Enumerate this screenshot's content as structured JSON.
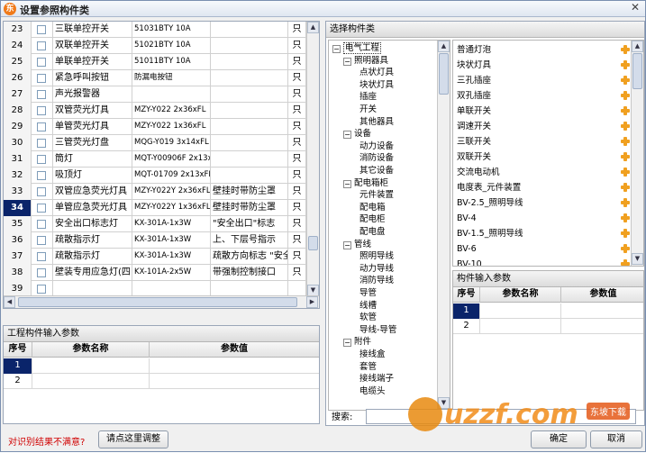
{
  "window": {
    "title": "设置参照构件类",
    "app_icon": "东",
    "close_glyph": "✕"
  },
  "main_grid": {
    "rows": [
      {
        "num": "23",
        "name": "三联单控开关",
        "model": "51031BTY 10A",
        "note": "",
        "unit": "只"
      },
      {
        "num": "24",
        "name": "双联单控开关",
        "model": "51021BTY 10A",
        "note": "",
        "unit": "只"
      },
      {
        "num": "25",
        "name": "单联单控开关",
        "model": "51011BTY 10A",
        "note": "",
        "unit": "只"
      },
      {
        "num": "26",
        "name": "紧急呼叫按钮",
        "model": "防漏电按钮",
        "note": "",
        "unit": "只"
      },
      {
        "num": "27",
        "name": "声光报警器",
        "model": "",
        "note": "",
        "unit": "只"
      },
      {
        "num": "28",
        "name": "双管荧光灯具",
        "model": "MZY-Y022 2x36xFL",
        "note": "",
        "unit": "只"
      },
      {
        "num": "29",
        "name": "单管荧光灯具",
        "model": "MZY-Y022 1x36xFL",
        "note": "",
        "unit": "只"
      },
      {
        "num": "30",
        "name": "三管荧光灯盘",
        "model": "MQG-Y019 3x14xFL",
        "note": "",
        "unit": "只"
      },
      {
        "num": "31",
        "name": "筒灯",
        "model": "MQT-Y00906F 2x13x",
        "note": "",
        "unit": "只"
      },
      {
        "num": "32",
        "name": "吸顶灯",
        "model": "MQT-01709 2x13xFL",
        "note": "",
        "unit": "只"
      },
      {
        "num": "33",
        "name": "双管应急荧光灯具",
        "model": "MZY-Y022Y 2x36xFL",
        "note": "壁挂时带防尘罩",
        "unit": "只"
      },
      {
        "num": "34",
        "name": "单管应急荧光灯具",
        "model": "MZY-Y022Y 1x36xFL",
        "note": "壁挂时带防尘罩",
        "unit": "只"
      },
      {
        "num": "35",
        "name": "安全出口标志灯",
        "model": "KX-301A-1x3W",
        "note": "\"安全出口\"标志",
        "unit": "只"
      },
      {
        "num": "36",
        "name": "疏散指示灯",
        "model": "KX-301A-1x3W",
        "note": "上、下层号指示",
        "unit": "只"
      },
      {
        "num": "37",
        "name": "疏散指示灯",
        "model": "KX-301A-1x3W",
        "note": "疏散方向标志 \"安全",
        "unit": "只"
      },
      {
        "num": "38",
        "name": "壁装专用应急灯(四",
        "model": "KX-101A-2x5W",
        "note": "带强制控制接口",
        "unit": "只"
      },
      {
        "num": "39",
        "name": "",
        "model": "",
        "note": "",
        "unit": ""
      }
    ],
    "active_row": "34"
  },
  "project_params": {
    "title": "工程构件输入参数",
    "headers": {
      "num": "序号",
      "name": "参数名称",
      "value": "参数值"
    },
    "rows": [
      {
        "num": "1"
      },
      {
        "num": "2"
      }
    ]
  },
  "category_panel": {
    "title": "选择构件类",
    "tree": [
      {
        "label": "电气工程",
        "level": 0,
        "exp": "−",
        "sel": true
      },
      {
        "label": "照明器具",
        "level": 1,
        "exp": "−"
      },
      {
        "label": "点状灯具",
        "level": 2
      },
      {
        "label": "块状灯具",
        "level": 2
      },
      {
        "label": "插座",
        "level": 2
      },
      {
        "label": "开关",
        "level": 2
      },
      {
        "label": "其他器具",
        "level": 2
      },
      {
        "label": "设备",
        "level": 1,
        "exp": "−"
      },
      {
        "label": "动力设备",
        "level": 2
      },
      {
        "label": "消防设备",
        "level": 2
      },
      {
        "label": "其它设备",
        "level": 2
      },
      {
        "label": "配电箱柜",
        "level": 1,
        "exp": "−"
      },
      {
        "label": "元件装置",
        "level": 2
      },
      {
        "label": "配电箱",
        "level": 2
      },
      {
        "label": "配电柜",
        "level": 2
      },
      {
        "label": "配电盘",
        "level": 2
      },
      {
        "label": "管线",
        "level": 1,
        "exp": "−"
      },
      {
        "label": "照明导线",
        "level": 2
      },
      {
        "label": "动力导线",
        "level": 2
      },
      {
        "label": "消防导线",
        "level": 2
      },
      {
        "label": "导管",
        "level": 2
      },
      {
        "label": "线槽",
        "level": 2
      },
      {
        "label": "软管",
        "level": 2
      },
      {
        "label": "导线-导管",
        "level": 2
      },
      {
        "label": "附件",
        "level": 1,
        "exp": "−"
      },
      {
        "label": "接线盒",
        "level": 2
      },
      {
        "label": "套管",
        "level": 2
      },
      {
        "label": "接线端子",
        "level": 2
      },
      {
        "label": "电缆头",
        "level": 2
      }
    ],
    "items": [
      "普通灯泡",
      "块状灯具",
      "三孔插座",
      "双孔插座",
      "单联开关",
      "调速开关",
      "三联开关",
      "双联开关",
      "交流电动机",
      "电度表_元件装置",
      "BV-2.5_照明导线",
      "BV-4",
      "BV-1.5_照明导线",
      "BV-6",
      "BV-10"
    ],
    "search_label": "搜索:"
  },
  "component_params": {
    "title": "构件输入参数",
    "headers": {
      "num": "序号",
      "name": "参数名称",
      "value": "参数值"
    },
    "rows": [
      {
        "num": "1"
      },
      {
        "num": "2"
      }
    ]
  },
  "footer": {
    "hint": "对识别结果不满意?",
    "adjust_button": "请点这里调整",
    "confirm_button": "确定",
    "cancel_button": "取消"
  },
  "watermark": {
    "logo": "uzzf.com",
    "tag": "东坡下载"
  },
  "colors": {
    "active_row": "#0a246a",
    "hint": "#d00000",
    "add_icon": "#f0a020"
  }
}
